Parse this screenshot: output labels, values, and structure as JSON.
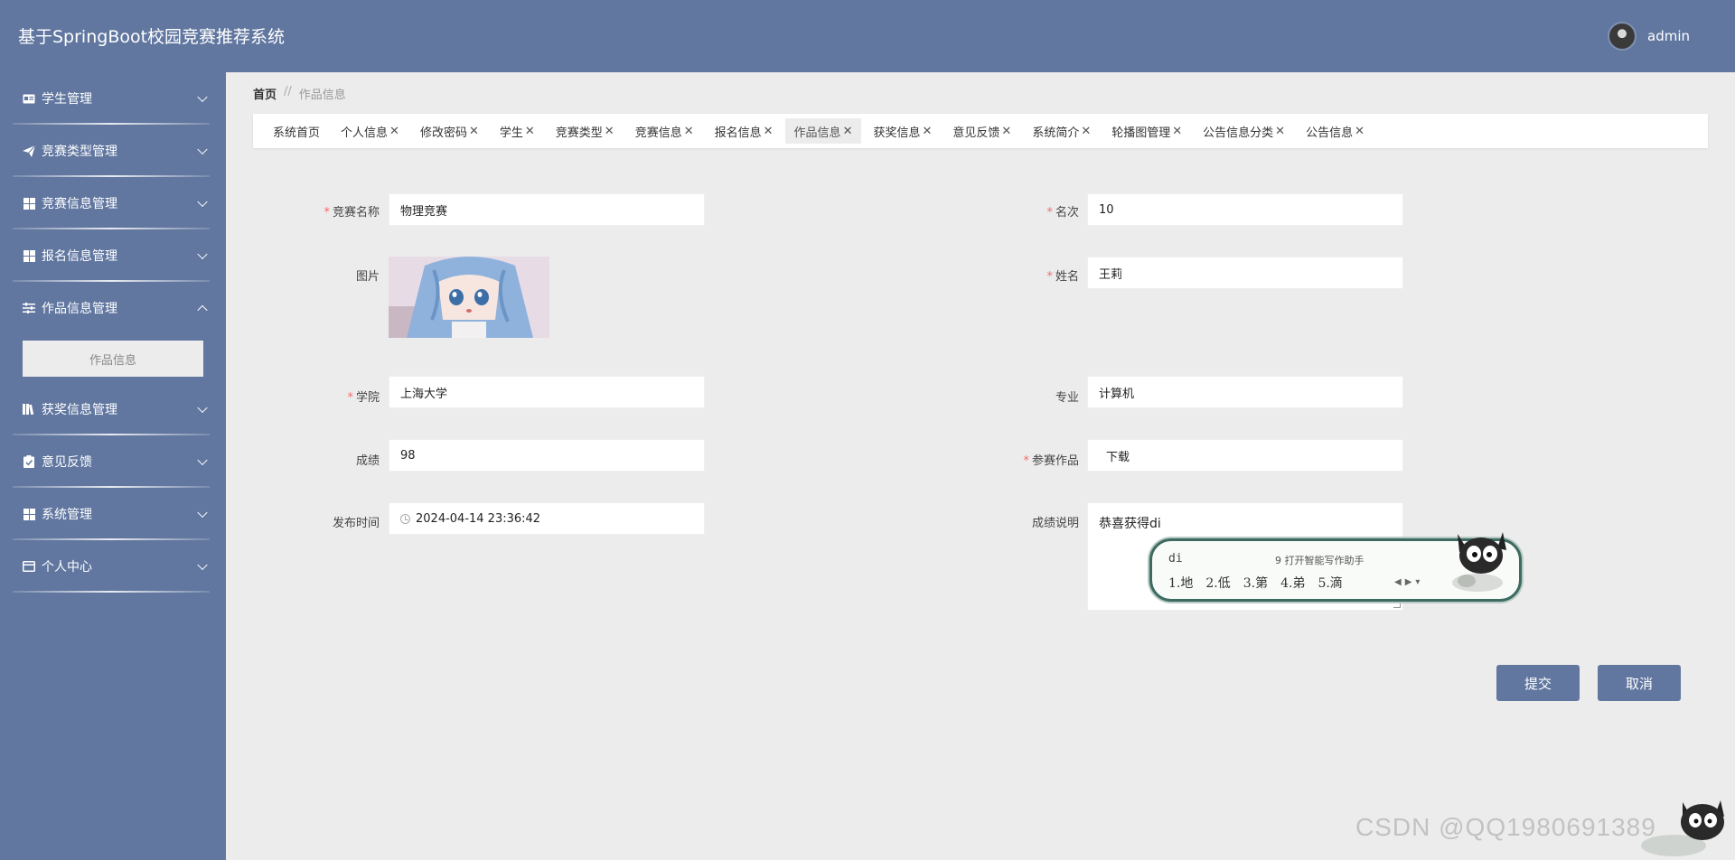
{
  "header": {
    "title": "基于SpringBoot校园竞赛推荐系统",
    "username": "admin"
  },
  "sidebar": {
    "items": [
      {
        "label": "学生管理",
        "icon": "id-card-icon"
      },
      {
        "label": "竞赛类型管理",
        "icon": "paper-plane-icon"
      },
      {
        "label": "竞赛信息管理",
        "icon": "grid-icon"
      },
      {
        "label": "报名信息管理",
        "icon": "grid-icon"
      },
      {
        "label": "作品信息管理",
        "icon": "sliders-icon",
        "expanded": true,
        "children": [
          "作品信息"
        ]
      },
      {
        "label": "获奖信息管理",
        "icon": "books-icon"
      },
      {
        "label": "意见反馈",
        "icon": "clipboard-check-icon"
      },
      {
        "label": "系统管理",
        "icon": "grid-icon"
      },
      {
        "label": "个人中心",
        "icon": "card-icon"
      }
    ]
  },
  "breadcrumb": {
    "home": "首页",
    "separator": "//",
    "current": "作品信息"
  },
  "tabs": [
    {
      "label": "系统首页",
      "closable": false
    },
    {
      "label": "个人信息",
      "closable": true
    },
    {
      "label": "修改密码",
      "closable": true
    },
    {
      "label": "学生",
      "closable": true
    },
    {
      "label": "竞赛类型",
      "closable": true
    },
    {
      "label": "竞赛信息",
      "closable": true
    },
    {
      "label": "报名信息",
      "closable": true
    },
    {
      "label": "作品信息",
      "closable": true,
      "active": true
    },
    {
      "label": "获奖信息",
      "closable": true
    },
    {
      "label": "意见反馈",
      "closable": true
    },
    {
      "label": "系统简介",
      "closable": true
    },
    {
      "label": "轮播图管理",
      "closable": true
    },
    {
      "label": "公告信息分类",
      "closable": true
    },
    {
      "label": "公告信息",
      "closable": true
    }
  ],
  "form": {
    "competition_name": {
      "label": "竞赛名称",
      "value": "物理竞赛",
      "required": true
    },
    "rank": {
      "label": "名次",
      "value": "10",
      "required": true
    },
    "image": {
      "label": "图片"
    },
    "student_name": {
      "label": "姓名",
      "value": "王莉",
      "required": true
    },
    "college": {
      "label": "学院",
      "value": "上海大学",
      "required": true
    },
    "major": {
      "label": "专业",
      "value": "计算机"
    },
    "score": {
      "label": "成绩",
      "value": "98"
    },
    "work": {
      "label": "参赛作品",
      "value": "下载",
      "required": true
    },
    "publish_time": {
      "label": "发布时间",
      "value": "2024-04-14 23:36:42"
    },
    "score_desc": {
      "label": "成绩说明",
      "value": "恭喜获得di"
    }
  },
  "ime": {
    "pinyin": "di",
    "assist": "9 打开智能写作助手",
    "candidates": [
      "1.地",
      "2.低",
      "3.第",
      "4.弟",
      "5.滴"
    ]
  },
  "buttons": {
    "submit": "提交",
    "cancel": "取消"
  },
  "watermark": "CSDN @QQ1980691389",
  "colors": {
    "primary": "#6177a0",
    "background": "#ececec",
    "required": "#f56c6c"
  }
}
